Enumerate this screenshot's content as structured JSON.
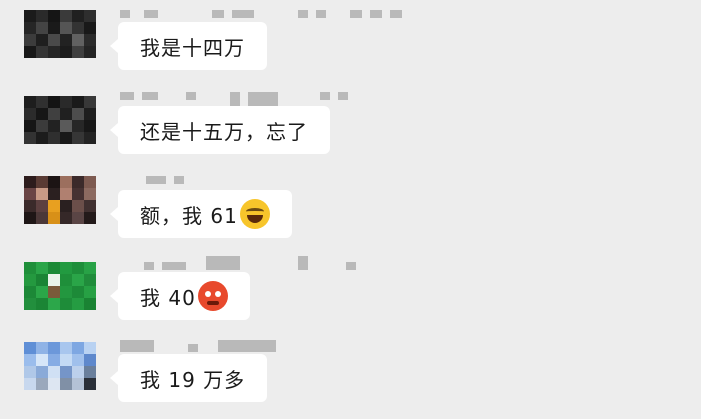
{
  "chat": {
    "messages": [
      {
        "text": "我是十四万",
        "emoji": ""
      },
      {
        "text": "还是十五万，忘了",
        "emoji": ""
      },
      {
        "text": "额，我 61",
        "emoji": "rolling-on-floor-laughing-icon"
      },
      {
        "text": "我 40",
        "emoji": "angry-face-icon"
      },
      {
        "text": "我 19 万多",
        "emoji": ""
      }
    ]
  },
  "colors": {
    "background": "#ededed",
    "bubble": "#ffffff",
    "text": "#1a1a1a",
    "blurred_name": "#b9b9b9"
  }
}
